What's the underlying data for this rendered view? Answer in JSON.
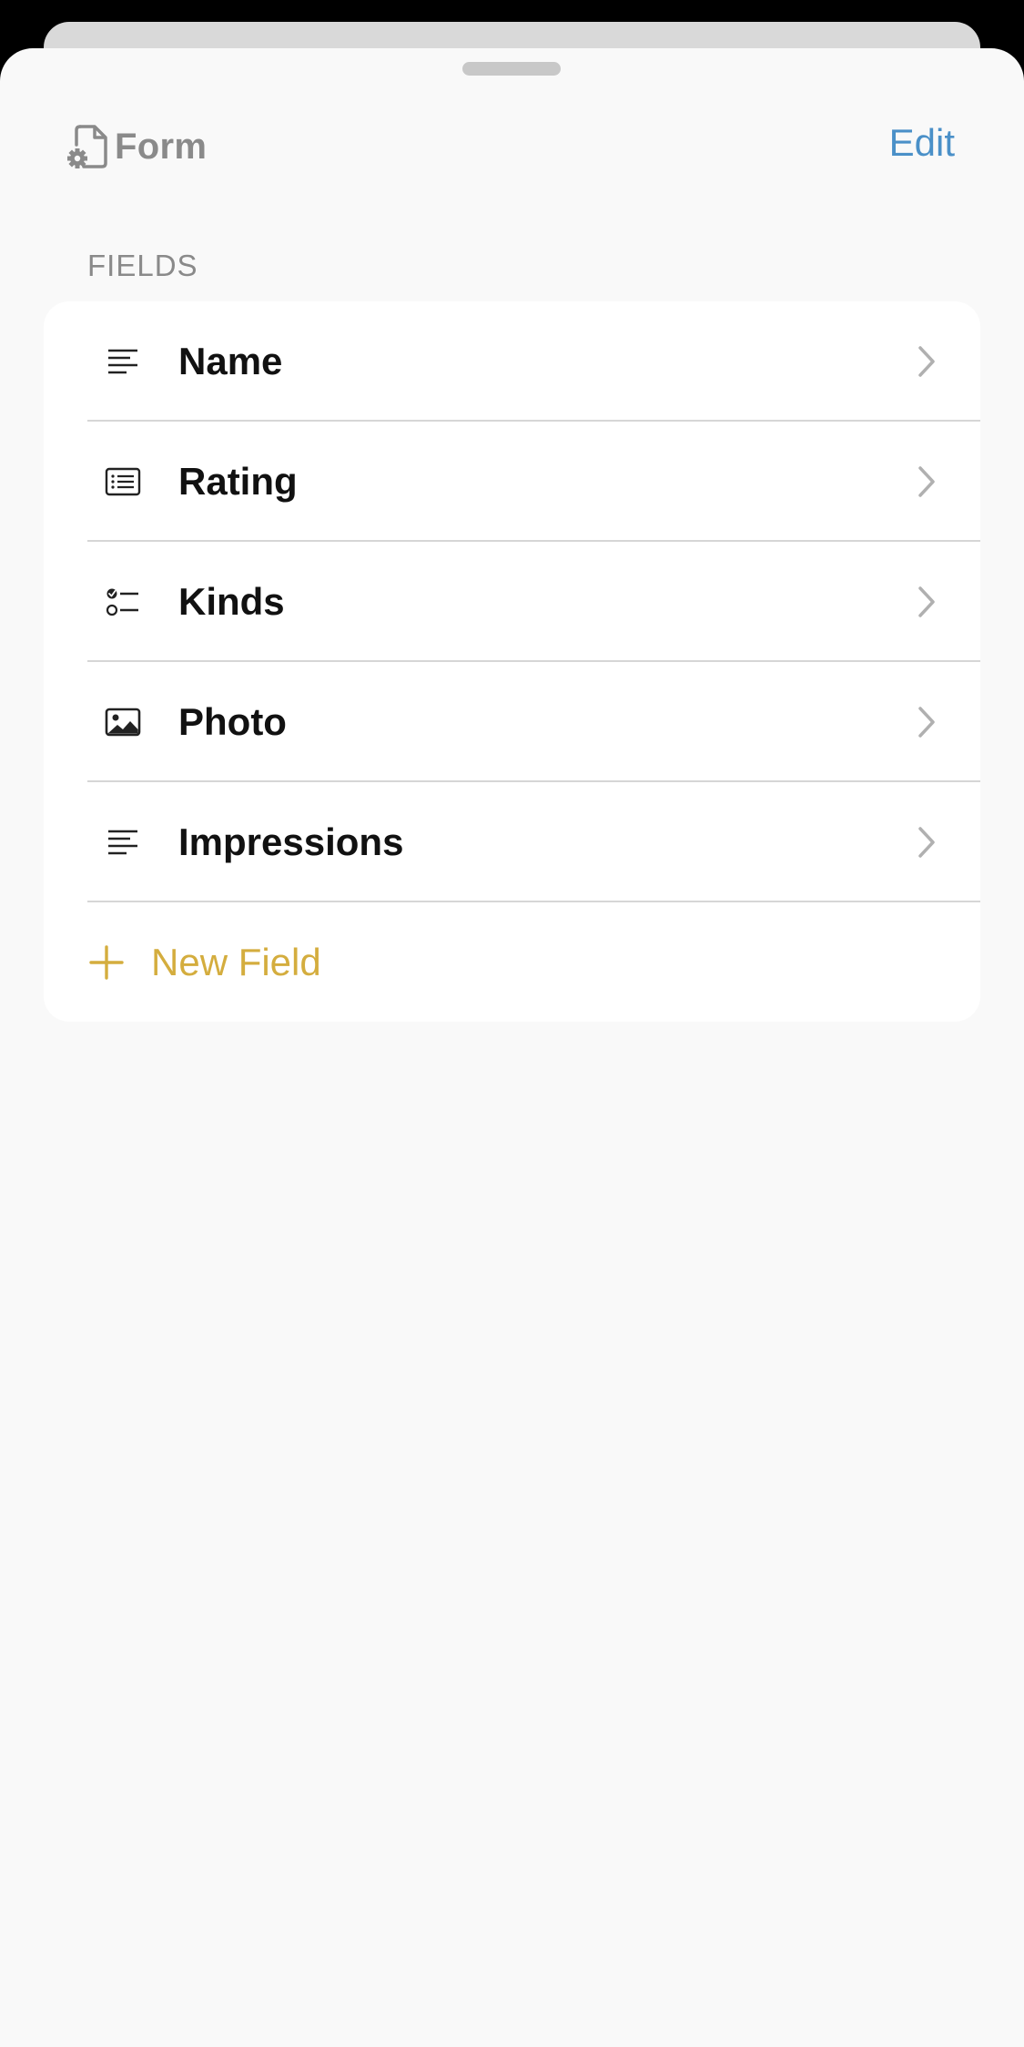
{
  "header": {
    "title": "Form",
    "title_icon": "form-settings-icon",
    "edit_label": "Edit"
  },
  "colors": {
    "edit_accent": "#4a90c8",
    "new_field_accent": "#d4ad3e",
    "title_gray": "#8a8a8a"
  },
  "fields": {
    "section_label": "FIELDS",
    "items": [
      {
        "label": "Name",
        "icon": "text-lines-icon"
      },
      {
        "label": "Rating",
        "icon": "list-card-icon"
      },
      {
        "label": "Kinds",
        "icon": "checklist-icon"
      },
      {
        "label": "Photo",
        "icon": "photo-icon"
      },
      {
        "label": "Impressions",
        "icon": "text-lines-icon"
      }
    ],
    "new_field_label": "New Field"
  }
}
